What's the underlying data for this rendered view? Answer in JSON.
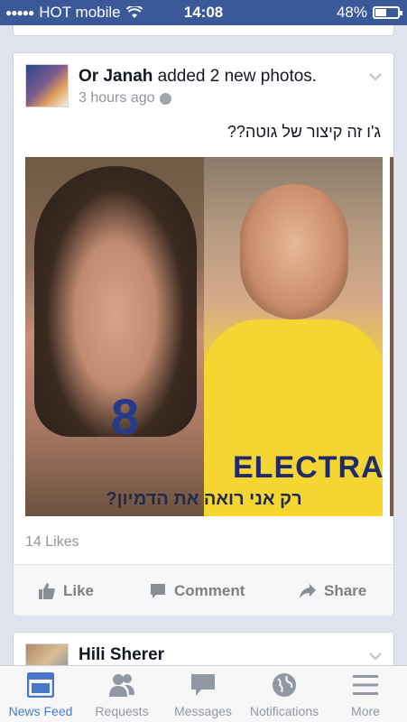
{
  "status_bar": {
    "signal_dots": "●●●●●",
    "carrier": "HOT mobile",
    "time": "14:08",
    "battery_percent": "48%",
    "battery_level": 0.48
  },
  "post": {
    "author": "Or Janah",
    "action": "added 2 new photos.",
    "time": "3 hours ago",
    "text": "ג'ו זה קיצור של גוטה??",
    "photo_caption": "רק אני רואה את הדמיון?",
    "jersey_number": "8",
    "jersey_text": "ELECTRA",
    "likes": "14 Likes",
    "actions": {
      "like": "Like",
      "comment": "Comment",
      "share": "Share"
    }
  },
  "next_post": {
    "author": "Hili Sherer"
  },
  "tab_bar": {
    "items": [
      {
        "label": "News Feed",
        "icon": "news-feed-icon",
        "active": true
      },
      {
        "label": "Requests",
        "icon": "requests-icon",
        "active": false
      },
      {
        "label": "Messages",
        "icon": "messages-icon",
        "active": false
      },
      {
        "label": "Notifications",
        "icon": "globe-icon",
        "active": false
      },
      {
        "label": "More",
        "icon": "menu-icon",
        "active": false
      }
    ]
  },
  "colors": {
    "brand_blue": "#3b5998",
    "active_tab": "#4a78c9",
    "inactive_tab": "#9197a3",
    "background": "#dfe3ee"
  }
}
